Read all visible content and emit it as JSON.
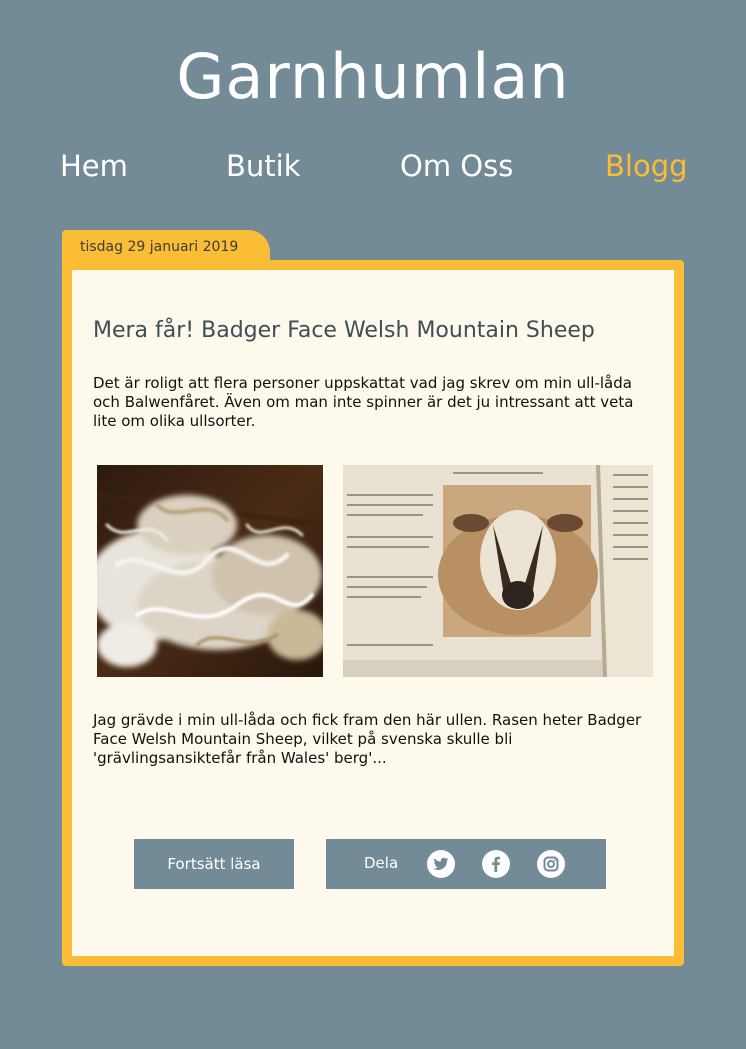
{
  "site": {
    "title": "Garnhumlan"
  },
  "nav": {
    "items": [
      {
        "label": "Hem"
      },
      {
        "label": "Butik"
      },
      {
        "label": "Om Oss"
      },
      {
        "label": "Blogg",
        "active": true
      }
    ]
  },
  "post": {
    "date": "tisdag 29 januari 2019",
    "title": "Mera får! Badger Face Welsh Mountain Sheep",
    "intro": "Det är roligt att flera personer uppskattat vad jag skrev om min ull-låda och Balwenfåret. Även om man inte spinner är det ju intressant att veta lite om olika ullsorter.",
    "body": "Jag grävde i min ull-låda och fick fram den här ullen. Rasen heter Badger Face Welsh Mountain Sheep, vilket på svenska skulle bli 'grävlingsansiktefår från Wales' berg'...",
    "read_more_label": "Fortsätt läsa",
    "share_label": "Dela",
    "share_icons": [
      "twitter-icon",
      "facebook-icon",
      "instagram-icon"
    ]
  },
  "colors": {
    "background": "#728b96",
    "accent": "#fbbd35",
    "card": "#fdf9ec"
  }
}
